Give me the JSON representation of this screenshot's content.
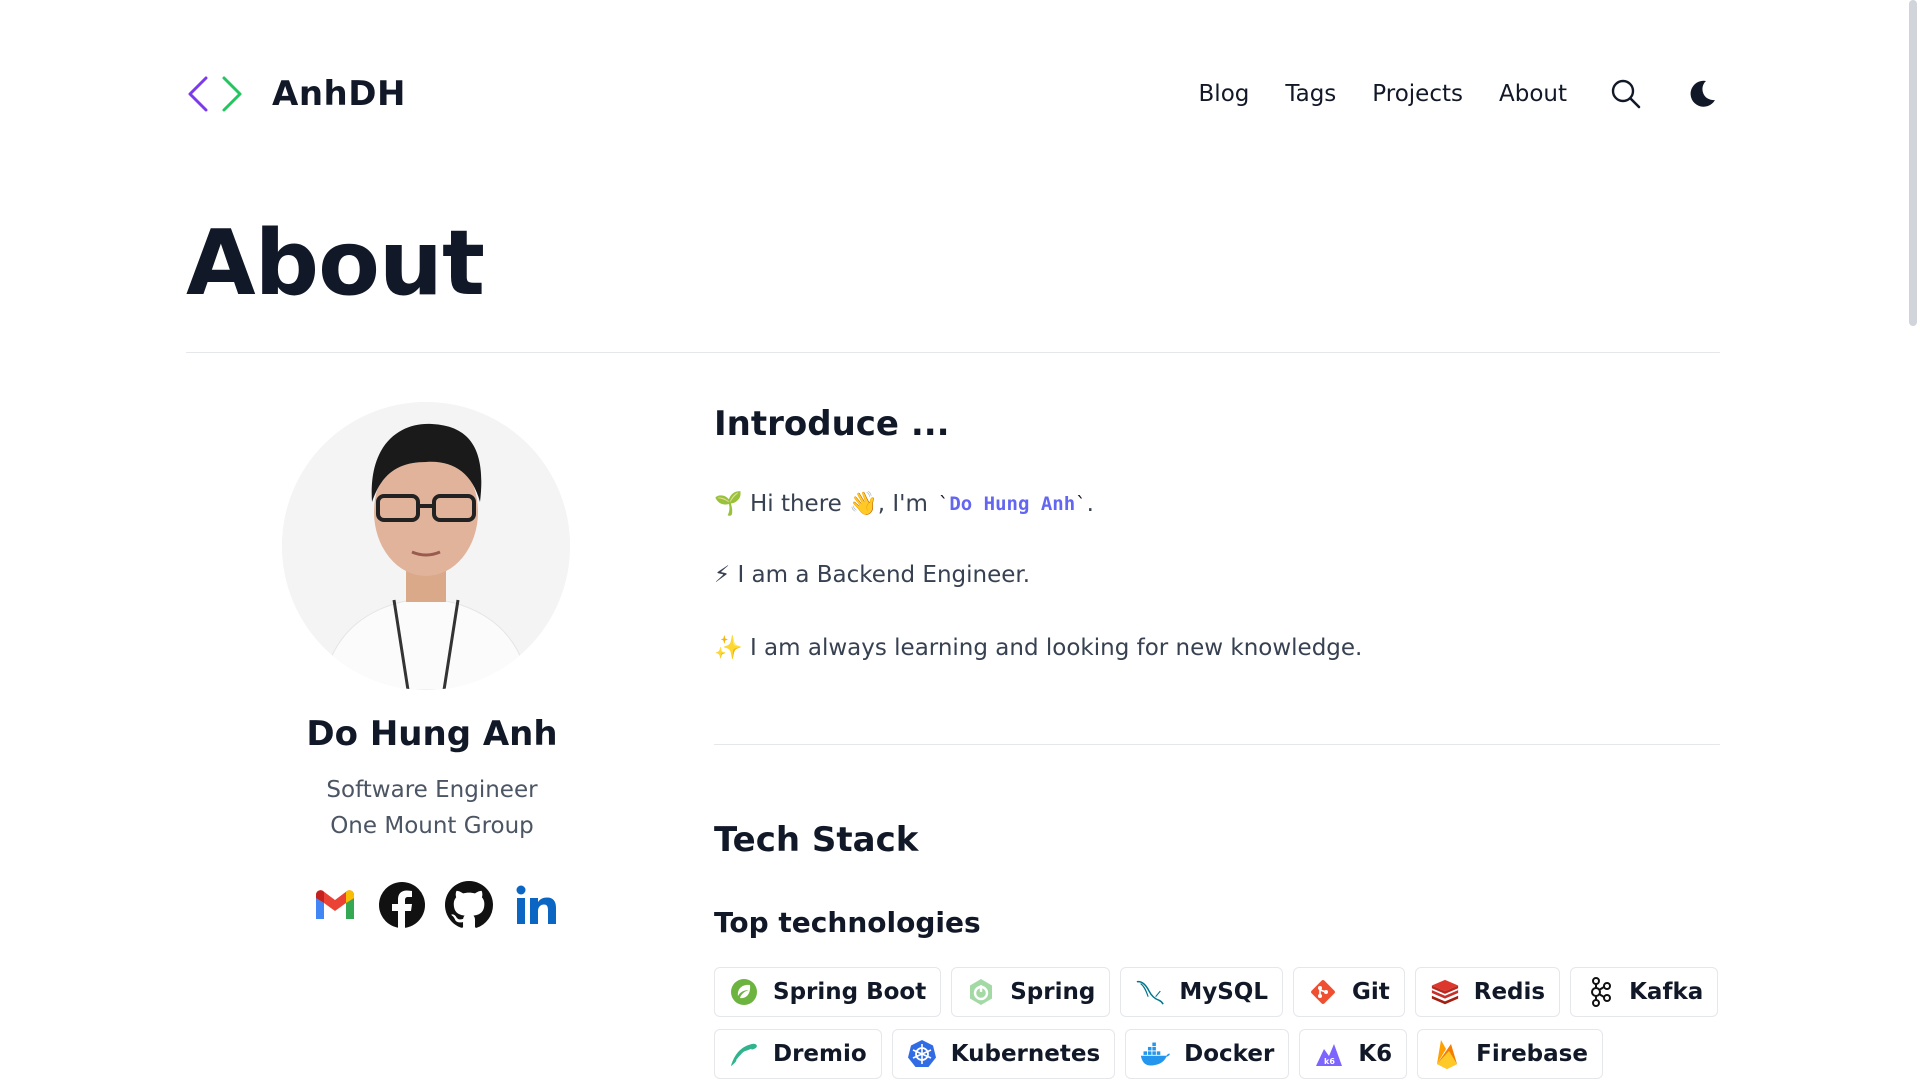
{
  "header": {
    "brand_name": "AnhDH",
    "nav": [
      "Blog",
      "Tags",
      "Projects",
      "About"
    ],
    "icons": [
      "search-icon",
      "moon-icon"
    ]
  },
  "page": {
    "title": "About"
  },
  "profile": {
    "name": "Do Hung Anh",
    "role": "Software Engineer",
    "company": "One Mount Group",
    "socials": [
      "gmail-icon",
      "facebook-icon",
      "github-icon",
      "linkedin-icon"
    ]
  },
  "intro": {
    "heading": "Introduce ...",
    "line1_prefix": "🌱 Hi there 👋, I'm",
    "line1_code": "Do Hung Anh",
    "line1_suffix": ".",
    "line2": "⚡ I am a Backend Engineer.",
    "line3": "✨ I am always learning and looking for new knowledge."
  },
  "tech": {
    "heading": "Tech Stack",
    "subheading": "Top technologies",
    "items": [
      {
        "label": "Spring Boot",
        "icon": "spring-boot-icon"
      },
      {
        "label": "Spring",
        "icon": "spring-icon"
      },
      {
        "label": "MySQL",
        "icon": "mysql-icon"
      },
      {
        "label": "Git",
        "icon": "git-icon"
      },
      {
        "label": "Redis",
        "icon": "redis-icon"
      },
      {
        "label": "Kafka",
        "icon": "kafka-icon"
      },
      {
        "label": "Dremio",
        "icon": "dremio-icon"
      },
      {
        "label": "Kubernetes",
        "icon": "kubernetes-icon"
      },
      {
        "label": "Docker",
        "icon": "docker-icon"
      },
      {
        "label": "K6",
        "icon": "k6-icon"
      },
      {
        "label": "Firebase",
        "icon": "firebase-icon"
      }
    ]
  },
  "colors": {
    "accent": "#6366f1",
    "logo_left": "#6d28d9",
    "logo_right": "#22c55e"
  }
}
